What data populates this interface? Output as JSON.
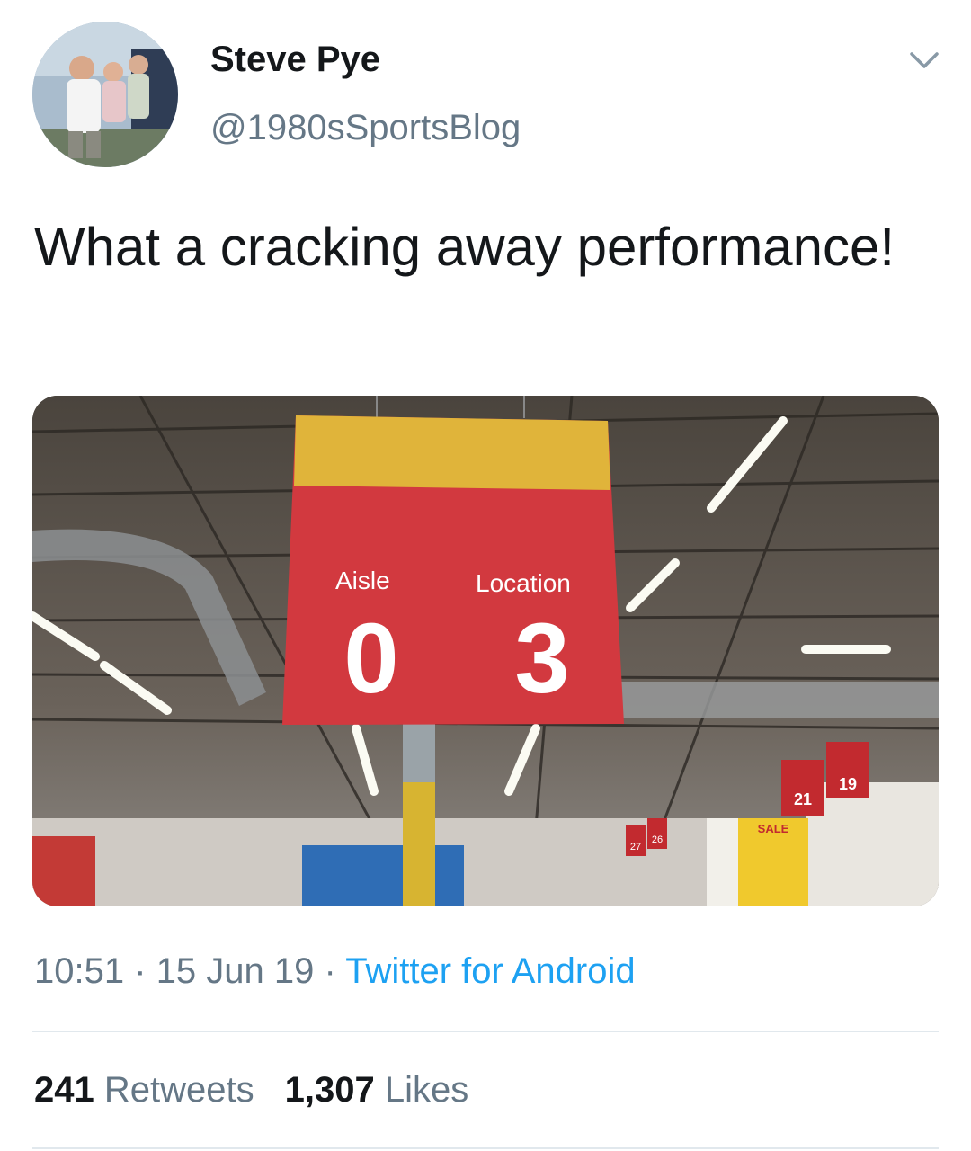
{
  "author": {
    "name": "Steve Pye",
    "handle": "@1980sSportsBlog"
  },
  "tweet": {
    "text": "What a cracking away performance!",
    "time": "10:51",
    "date": "15 Jun 19",
    "source": "Twitter for Android",
    "separator": "·"
  },
  "media": {
    "sign": {
      "aisle_label": "Aisle",
      "location_label": "Location",
      "aisle_value": "0",
      "location_value": "3"
    },
    "small_signs": [
      "21",
      "19",
      "27",
      "26"
    ],
    "sale_label": "SALE"
  },
  "stats": {
    "retweets_count": "241",
    "retweets_label": "Retweets",
    "likes_count": "1,307",
    "likes_label": "Likes"
  },
  "colors": {
    "accent": "#1da1f2",
    "secondary_text": "#657786",
    "sign_red": "#d2393f",
    "sign_yellow": "#e0b43a"
  },
  "icons": {
    "menu": "chevron-down-icon"
  }
}
